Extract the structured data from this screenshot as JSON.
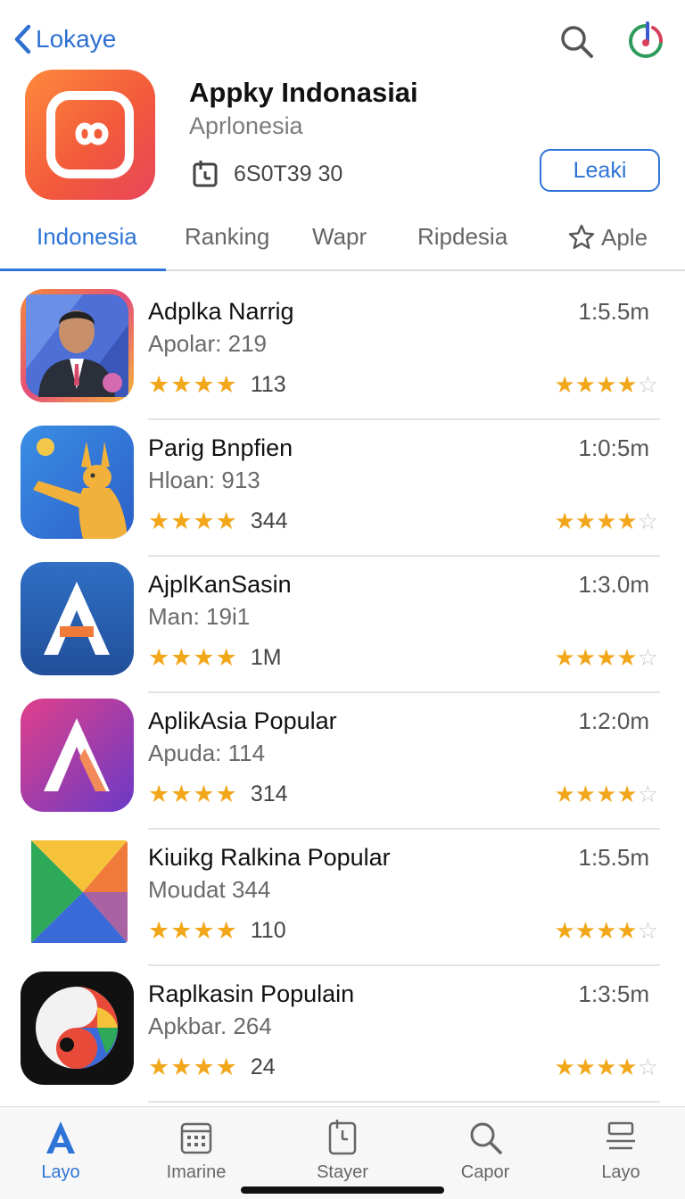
{
  "nav": {
    "back_label": "Lokaye"
  },
  "app": {
    "title": "Appky Indonasiai",
    "subtitle": "Aprlonesia",
    "meta": "6S0T39 30",
    "get_label": "Leaki"
  },
  "tabs": [
    {
      "label": "Indonesia",
      "active": true
    },
    {
      "label": "Ranking",
      "active": false
    },
    {
      "label": "Wapr",
      "active": false
    },
    {
      "label": "Ripdesia",
      "active": false
    },
    {
      "label": "Aple",
      "active": false,
      "icon": "star-outline-icon"
    }
  ],
  "list": [
    {
      "title": "Adplka Narrig",
      "subtitle": "Apolar: 219",
      "count": "113",
      "size": "1:5.5m",
      "rating": 3.5,
      "icon": "person-portrait-icon"
    },
    {
      "title": "Parig Bnpfien",
      "subtitle": "Hloan: 913",
      "count": "344",
      "size": "1:0:5m",
      "rating": 4,
      "icon": "kangaroo-icon"
    },
    {
      "title": "AjplKanSasin",
      "subtitle": "Man: 19i1",
      "count": "1M",
      "size": "1:3.0m",
      "rating": 3.5,
      "icon": "letter-a-blue-icon"
    },
    {
      "title": "AplikAsia Popular",
      "subtitle": "Apuda: 114",
      "count": "314",
      "size": "1:2:0m",
      "rating": 4,
      "icon": "letter-a-purple-icon"
    },
    {
      "title": "Kiuikg Ralkina Popular",
      "subtitle": "Moudat 344",
      "count": "110",
      "size": "1:5.5m",
      "rating": 4,
      "icon": "play-triangle-icon"
    },
    {
      "title": "Raplkasin Populain",
      "subtitle": "Apkbar. 264",
      "count": "24",
      "size": "1:3:5m",
      "rating": 3.5,
      "icon": "yin-yang-color-icon"
    }
  ],
  "bottom_tabs": [
    {
      "label": "Layo",
      "active": true,
      "icon": "app-store-a-icon"
    },
    {
      "label": "Imarine",
      "active": false,
      "icon": "calendar-icon"
    },
    {
      "label": "Stayer",
      "active": false,
      "icon": "clipboard-icon"
    },
    {
      "label": "Capor",
      "active": false,
      "icon": "search-icon"
    },
    {
      "label": "Layo",
      "active": false,
      "icon": "stack-icon"
    }
  ],
  "colors": {
    "accent": "#2d74d6",
    "star": "#f2a71b"
  }
}
